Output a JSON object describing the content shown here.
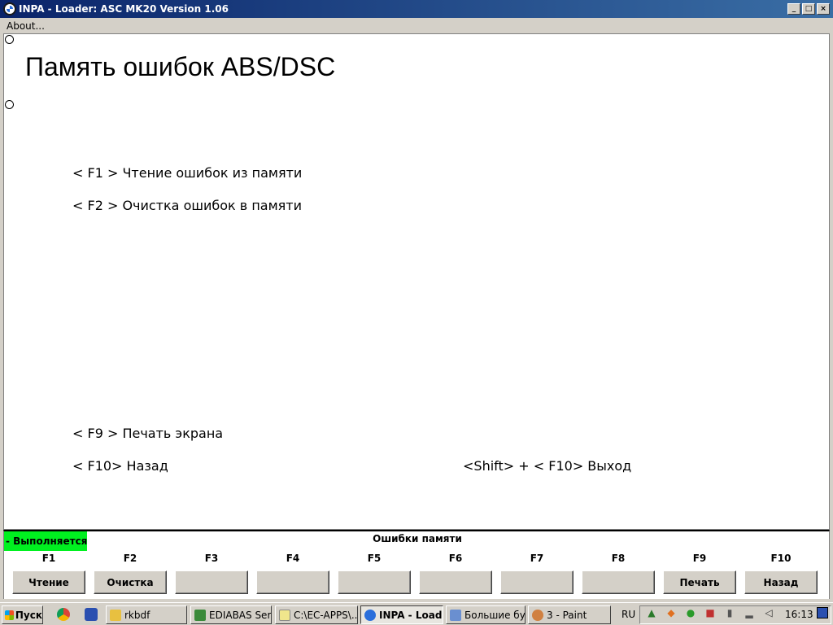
{
  "window": {
    "title": "INPA - Loader:  ASC MK20 Version 1.06",
    "minimize_glyph": "_",
    "maximize_glyph": "□",
    "close_glyph": "×"
  },
  "menu": {
    "about_label": "About..."
  },
  "content": {
    "title": "Память ошибок ABS/DSC",
    "f1_line": "< F1 >  Чтение ошибок из памяти",
    "f2_line": "< F2 >  Очистка ошибок в памяти",
    "f9_line": "< F9 >  Печать экрана",
    "f10_line": "< F10>  Назад",
    "shift_f10_line": "<Shift> + < F10>  Выход"
  },
  "panel": {
    "status": "- Выполняется",
    "status_color": "#00f020",
    "title": "Ошибки памяти",
    "keys": [
      {
        "label": "F1",
        "button": "Чтение"
      },
      {
        "label": "F2",
        "button": "Очистка"
      },
      {
        "label": "F3",
        "button": ""
      },
      {
        "label": "F4",
        "button": ""
      },
      {
        "label": "F5",
        "button": ""
      },
      {
        "label": "F6",
        "button": ""
      },
      {
        "label": "F7",
        "button": ""
      },
      {
        "label": "F8",
        "button": ""
      },
      {
        "label": "F9",
        "button": "Печать"
      },
      {
        "label": "F10",
        "button": "Назад"
      }
    ]
  },
  "taskbar": {
    "start_label": "Пуск",
    "tasks": [
      {
        "label": "rkbdf",
        "icon": "folder-icon",
        "color": "#e8c040"
      },
      {
        "label": "EDIABAS Ser...",
        "icon": "ediabas-icon",
        "color": "#3a8a3a"
      },
      {
        "label": "C:\\EC-APPS\\...",
        "icon": "notepad-icon",
        "color": "#f0e68c"
      },
      {
        "label": "INPA - Load...",
        "icon": "bmw-icon",
        "color": "#2a6fdb",
        "active": true
      },
      {
        "label": "Большие бу...",
        "icon": "document-icon",
        "color": "#6a8fd0"
      },
      {
        "label": "3 - Paint",
        "icon": "paint-icon",
        "color": "#d08040"
      }
    ],
    "language": "RU",
    "clock": "16:13"
  }
}
